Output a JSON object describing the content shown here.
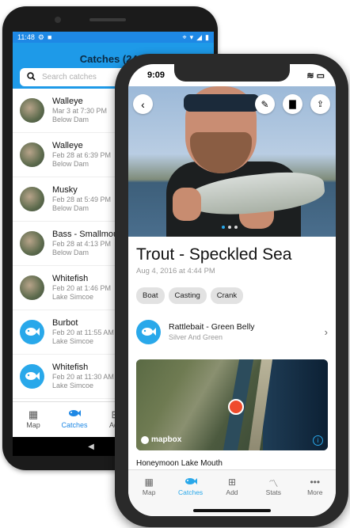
{
  "android": {
    "status": {
      "time": "11:48"
    },
    "app_title": "Catches (249)",
    "search_placeholder": "Search catches",
    "catches": [
      {
        "name": "Walleye",
        "date": "Mar 3 at 7:30 PM",
        "location": "Below Dam",
        "avatar": "photo"
      },
      {
        "name": "Walleye",
        "date": "Feb 28 at 6:39 PM",
        "location": "Below Dam",
        "avatar": "photo"
      },
      {
        "name": "Musky",
        "date": "Feb 28 at 5:49 PM",
        "location": "Below Dam",
        "avatar": "photo"
      },
      {
        "name": "Bass - Smallmouth",
        "date": "Feb 28 at 4:13 PM",
        "location": "Below Dam",
        "avatar": "photo"
      },
      {
        "name": "Whitefish",
        "date": "Feb 20 at 1:46 PM",
        "location": "Lake Simcoe",
        "avatar": "photo"
      },
      {
        "name": "Burbot",
        "date": "Feb 20 at 11:55 AM",
        "location": "Lake Simcoe",
        "avatar": "icon"
      },
      {
        "name": "Whitefish",
        "date": "Feb 20 at 11:30 AM",
        "location": "Lake Simcoe",
        "avatar": "icon"
      }
    ],
    "nav": [
      {
        "label": "Map",
        "icon": "map-icon",
        "active": false
      },
      {
        "label": "Catches",
        "icon": "fish-icon",
        "active": true
      },
      {
        "label": "Add",
        "icon": "add-icon",
        "active": false
      }
    ]
  },
  "iphone": {
    "status": {
      "time": "9:09"
    },
    "catch_title": "Trout - Speckled Sea",
    "catch_datetime": "Aug 4, 2016 at 4:44 PM",
    "tags": [
      "Boat",
      "Casting",
      "Crank"
    ],
    "bait": {
      "name": "Rattlebait - Green Belly",
      "variant": "Silver And Green"
    },
    "map_attribution": "mapbox",
    "location_name": "Honeymoon Lake Mouth",
    "nav": [
      {
        "label": "Map",
        "icon": "map-icon",
        "active": false
      },
      {
        "label": "Catches",
        "icon": "fish-icon",
        "active": true
      },
      {
        "label": "Add",
        "icon": "add-icon",
        "active": false
      },
      {
        "label": "Stats",
        "icon": "stats-icon",
        "active": false
      },
      {
        "label": "More",
        "icon": "more-icon",
        "active": false
      }
    ],
    "photo_index": 1,
    "photo_count": 3
  },
  "colors": {
    "accent": "#29a8ea",
    "appbar": "#1e9ae8",
    "pin": "#ef4b2c"
  }
}
